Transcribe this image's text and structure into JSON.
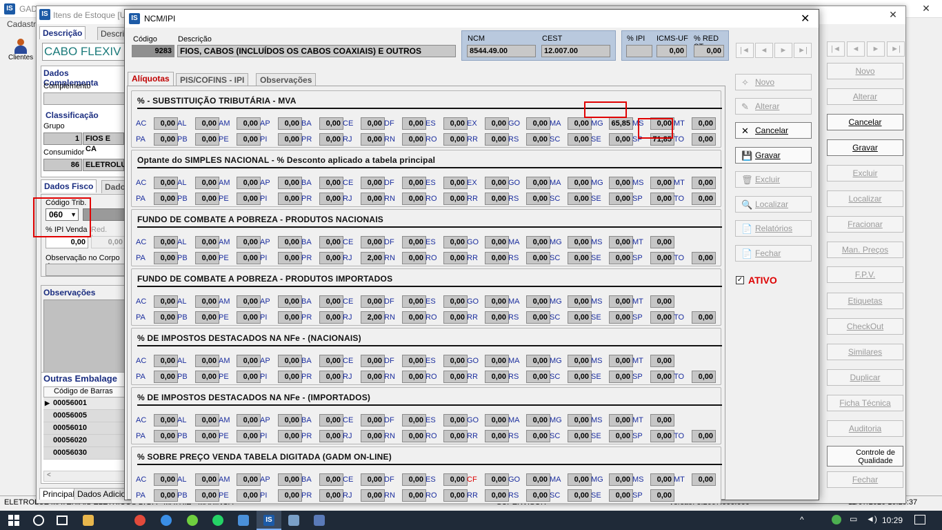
{
  "main": {
    "title": "GAD",
    "menu": "Cadastr",
    "clientes": "Clientes",
    "status_left": "ELETROLUZ MATERIAIS ELETRICOS LTDA - MATRIZ - MARINGA",
    "status_mid": "SUPERVISOR",
    "status_ver": "Versão: 3.2667.666.666",
    "status_date": "11/07/2020 10:25:37"
  },
  "item": {
    "title": "Itens de Estoque [U",
    "tab_desc": "Descrição",
    "tab_desc2": "Descri",
    "name": "CABO FLEXIV",
    "dados_comp": "Dados Complementa",
    "complemento": "Complemento",
    "classificacao": "Classificação",
    "grupo": "Grupo",
    "grupo_cod": "1",
    "grupo_nome": "FIOS E CA",
    "consumidor": "Consumidor",
    "cons_cod": "86",
    "cons_nome": "ELETROLU",
    "dados_fisco": "Dados Fisco",
    "dados_fisco2": "Dado",
    "cod_trib": "Código Trib.",
    "cod_trib_val": "060",
    "ipi_venda": "% IPI Venda",
    "red_icms": "Red. Icms",
    "ipi_val": "0,00",
    "red_val": "0,00",
    "obs_corpo": "Observação no Corpo da",
    "observacoes": "Observações",
    "outras_emb": "Outras Embalage",
    "cod_barras": "Código de Barras",
    "barcodes": [
      "00056001",
      "00056005",
      "00056010",
      "00056020",
      "00056030"
    ],
    "btab1": "Principal",
    "btab2": "Dados Adicion",
    "buttons": [
      "Novo",
      "Alterar",
      "Cancelar",
      "Gravar",
      "Excluir",
      "Localizar",
      "Fracionar",
      "Man. Preços",
      "F.P.V.",
      "Etiquetas",
      "CheckOut",
      "Similares",
      "Duplicar",
      "Ficha Técnica",
      "Auditoria",
      "Controle de Qualidade",
      "Fechar"
    ]
  },
  "dlg": {
    "title": "NCM/IPI",
    "codigo_lbl": "Código",
    "codigo": "9283",
    "descricao_lbl": "Descrição",
    "descricao": "FIOS, CABOS (INCLUÍDOS OS CABOS COAXIAIS) E OUTROS",
    "ncm_lbl": "NCM",
    "ncm": "8544.49.00",
    "cest_lbl": "CEST",
    "cest": "12.007.00",
    "ipi_lbl": "% IPI",
    "ipi": "",
    "icmsuf_lbl": "ICMS-UF",
    "icmsuf": "0,00",
    "redst_lbl": "% RED ST",
    "redst": "0,00",
    "tabs": [
      "Alíquotas",
      "PIS/COFINS - IPI",
      "Observações"
    ],
    "buttons": [
      "Novo",
      "Alterar",
      "Cancelar",
      "Gravar",
      "Excluir",
      "Localizar",
      "Relatórios",
      "Fechar"
    ],
    "ativo": "ATIVO",
    "sections": [
      {
        "title": "% - SUBSTITUIÇÃO TRIBUTÁRIA  - MVA",
        "r1": [
          [
            "AC",
            "0,00"
          ],
          [
            "AL",
            "0,00"
          ],
          [
            "AM",
            "0,00"
          ],
          [
            "AP",
            "0,00"
          ],
          [
            "BA",
            "0,00"
          ],
          [
            "CE",
            "0,00"
          ],
          [
            "DF",
            "0,00"
          ],
          [
            "ES",
            "0,00"
          ],
          [
            "EX",
            "0,00"
          ],
          [
            "GO",
            "0,00"
          ],
          [
            "MA",
            "0,00"
          ],
          [
            "MG",
            "65,85"
          ],
          [
            "MS",
            "0,00"
          ],
          [
            "MT",
            "0,00"
          ]
        ],
        "r2": [
          [
            "PA",
            "0,00"
          ],
          [
            "PB",
            "0,00"
          ],
          [
            "PE",
            "0,00"
          ],
          [
            "PI",
            "0,00"
          ],
          [
            "PR",
            "0,00"
          ],
          [
            "RJ",
            "0,00"
          ],
          [
            "RN",
            "0,00"
          ],
          [
            "RO",
            "0,00"
          ],
          [
            "RR",
            "0,00"
          ],
          [
            "RS",
            "0,00"
          ],
          [
            "SC",
            "0,00"
          ],
          [
            "SE",
            "0,00"
          ],
          [
            "SP",
            "71,85"
          ],
          [
            "TO",
            "0,00"
          ]
        ]
      },
      {
        "title": "Optante do SIMPLES NACIONAL - % Desconto aplicado a tabela principal",
        "r1": [
          [
            "AC",
            "0,00"
          ],
          [
            "AL",
            "0,00"
          ],
          [
            "AM",
            "0,00"
          ],
          [
            "AP",
            "0,00"
          ],
          [
            "BA",
            "0,00"
          ],
          [
            "CE",
            "0,00"
          ],
          [
            "DF",
            "0,00"
          ],
          [
            "ES",
            "0,00"
          ],
          [
            "EX",
            "0,00"
          ],
          [
            "GO",
            "0,00"
          ],
          [
            "MA",
            "0,00"
          ],
          [
            "MG",
            "0,00"
          ],
          [
            "MS",
            "0,00"
          ],
          [
            "MT",
            "0,00"
          ]
        ],
        "r2": [
          [
            "PA",
            "0,00"
          ],
          [
            "PB",
            "0,00"
          ],
          [
            "PE",
            "0,00"
          ],
          [
            "PI",
            "0,00"
          ],
          [
            "PR",
            "0,00"
          ],
          [
            "RJ",
            "0,00"
          ],
          [
            "RN",
            "0,00"
          ],
          [
            "RO",
            "0,00"
          ],
          [
            "RR",
            "0,00"
          ],
          [
            "RS",
            "0,00"
          ],
          [
            "SC",
            "0,00"
          ],
          [
            "SE",
            "0,00"
          ],
          [
            "SP",
            "0,00"
          ],
          [
            "TO",
            "0,00"
          ]
        ]
      },
      {
        "title": "FUNDO DE COMBATE A POBREZA - PRODUTOS NACIONAIS",
        "r1": [
          [
            "AC",
            "0,00"
          ],
          [
            "AL",
            "0,00"
          ],
          [
            "AM",
            "0,00"
          ],
          [
            "AP",
            "0,00"
          ],
          [
            "BA",
            "0,00"
          ],
          [
            "CE",
            "0,00"
          ],
          [
            "DF",
            "0,00"
          ],
          [
            "ES",
            "0,00"
          ],
          [
            "GO",
            "0,00"
          ],
          [
            "MA",
            "0,00"
          ],
          [
            "MG",
            "0,00"
          ],
          [
            "MS",
            "0,00"
          ],
          [
            "MT",
            "0,00"
          ]
        ],
        "r2": [
          [
            "PA",
            "0,00"
          ],
          [
            "PB",
            "0,00"
          ],
          [
            "PE",
            "0,00"
          ],
          [
            "PI",
            "0,00"
          ],
          [
            "PR",
            "0,00"
          ],
          [
            "RJ",
            "2,00"
          ],
          [
            "RN",
            "0,00"
          ],
          [
            "RO",
            "0,00"
          ],
          [
            "RR",
            "0,00"
          ],
          [
            "RS",
            "0,00"
          ],
          [
            "SC",
            "0,00"
          ],
          [
            "SE",
            "0,00"
          ],
          [
            "SP",
            "0,00"
          ],
          [
            "TO",
            "0,00"
          ]
        ]
      },
      {
        "title": "FUNDO DE COMBATE A POBREZA - PRODUTOS IMPORTADOS",
        "r1": [
          [
            "AC",
            "0,00"
          ],
          [
            "AL",
            "0,00"
          ],
          [
            "AM",
            "0,00"
          ],
          [
            "AP",
            "0,00"
          ],
          [
            "BA",
            "0,00"
          ],
          [
            "CE",
            "0,00"
          ],
          [
            "DF",
            "0,00"
          ],
          [
            "ES",
            "0,00"
          ],
          [
            "GO",
            "0,00"
          ],
          [
            "MA",
            "0,00"
          ],
          [
            "MG",
            "0,00"
          ],
          [
            "MS",
            "0,00"
          ],
          [
            "MT",
            "0,00"
          ]
        ],
        "r2": [
          [
            "PA",
            "0,00"
          ],
          [
            "PB",
            "0,00"
          ],
          [
            "PE",
            "0,00"
          ],
          [
            "PI",
            "0,00"
          ],
          [
            "PR",
            "0,00"
          ],
          [
            "RJ",
            "2,00"
          ],
          [
            "RN",
            "0,00"
          ],
          [
            "RO",
            "0,00"
          ],
          [
            "RR",
            "0,00"
          ],
          [
            "RS",
            "0,00"
          ],
          [
            "SC",
            "0,00"
          ],
          [
            "SE",
            "0,00"
          ],
          [
            "SP",
            "0,00"
          ],
          [
            "TO",
            "0,00"
          ]
        ]
      },
      {
        "title": "% DE IMPOSTOS DESTACADOS NA NFe - (NACIONAIS)",
        "r1": [
          [
            "AC",
            "0,00"
          ],
          [
            "AL",
            "0,00"
          ],
          [
            "AM",
            "0,00"
          ],
          [
            "AP",
            "0,00"
          ],
          [
            "BA",
            "0,00"
          ],
          [
            "CE",
            "0,00"
          ],
          [
            "DF",
            "0,00"
          ],
          [
            "ES",
            "0,00"
          ],
          [
            "GO",
            "0,00"
          ],
          [
            "MA",
            "0,00"
          ],
          [
            "MG",
            "0,00"
          ],
          [
            "MS",
            "0,00"
          ],
          [
            "MT",
            "0,00"
          ]
        ],
        "r2": [
          [
            "PA",
            "0,00"
          ],
          [
            "PB",
            "0,00"
          ],
          [
            "PE",
            "0,00"
          ],
          [
            "PI",
            "0,00"
          ],
          [
            "PR",
            "0,00"
          ],
          [
            "RJ",
            "0,00"
          ],
          [
            "RN",
            "0,00"
          ],
          [
            "RO",
            "0,00"
          ],
          [
            "RR",
            "0,00"
          ],
          [
            "RS",
            "0,00"
          ],
          [
            "SC",
            "0,00"
          ],
          [
            "SE",
            "0,00"
          ],
          [
            "SP",
            "0,00"
          ],
          [
            "TO",
            "0,00"
          ]
        ]
      },
      {
        "title": "% DE IMPOSTOS DESTACADOS NA NFe - (IMPORTADOS)",
        "r1": [
          [
            "AC",
            "0,00"
          ],
          [
            "AL",
            "0,00"
          ],
          [
            "AM",
            "0,00"
          ],
          [
            "AP",
            "0,00"
          ],
          [
            "BA",
            "0,00"
          ],
          [
            "CE",
            "0,00"
          ],
          [
            "DF",
            "0,00"
          ],
          [
            "ES",
            "0,00"
          ],
          [
            "GO",
            "0,00"
          ],
          [
            "MA",
            "0,00"
          ],
          [
            "MG",
            "0,00"
          ],
          [
            "MS",
            "0,00"
          ],
          [
            "MT",
            "0,00"
          ]
        ],
        "r2": [
          [
            "PA",
            "0,00"
          ],
          [
            "PB",
            "0,00"
          ],
          [
            "PE",
            "0,00"
          ],
          [
            "PI",
            "0,00"
          ],
          [
            "PR",
            "0,00"
          ],
          [
            "RJ",
            "0,00"
          ],
          [
            "RN",
            "0,00"
          ],
          [
            "RO",
            "0,00"
          ],
          [
            "RR",
            "0,00"
          ],
          [
            "RS",
            "0,00"
          ],
          [
            "SC",
            "0,00"
          ],
          [
            "SE",
            "0,00"
          ],
          [
            "SP",
            "0,00"
          ],
          [
            "TO",
            "0,00"
          ]
        ]
      },
      {
        "title": "% SOBRE PREÇO VENDA TABELA DIGITADA (GADM ON-LINE)",
        "r1": [
          [
            "AC",
            "0,00"
          ],
          [
            "AL",
            "0,00"
          ],
          [
            "AM",
            "0,00"
          ],
          [
            "AP",
            "0,00"
          ],
          [
            "BA",
            "0,00"
          ],
          [
            "CE",
            "0,00"
          ],
          [
            "DF",
            "0,00"
          ],
          [
            "ES",
            "0,00"
          ],
          [
            "CF",
            "0,00"
          ],
          [
            "GO",
            "0,00"
          ],
          [
            "MA",
            "0,00"
          ],
          [
            "MG",
            "0,00"
          ],
          [
            "MS",
            "0,00"
          ],
          [
            "MT",
            "0,00"
          ]
        ],
        "r2": [
          [
            "PA",
            "0,00"
          ],
          [
            "PB",
            "0,00"
          ],
          [
            "PE",
            "0,00"
          ],
          [
            "PI",
            "0,00"
          ],
          [
            "PR",
            "0,00"
          ],
          [
            "RJ",
            "0,00"
          ],
          [
            "RN",
            "0,00"
          ],
          [
            "RO",
            "0,00"
          ],
          [
            "RR",
            "0,00"
          ],
          [
            "RS",
            "0,00"
          ],
          [
            "SC",
            "0,00"
          ],
          [
            "SE",
            "0,00"
          ],
          [
            "SP",
            "0,00"
          ]
        ]
      }
    ]
  },
  "taskbar": {
    "time": "10:29"
  },
  "colors": {
    "accent": "#1a2d80",
    "highlight": "#e00000",
    "field": "#c6c6c6"
  }
}
